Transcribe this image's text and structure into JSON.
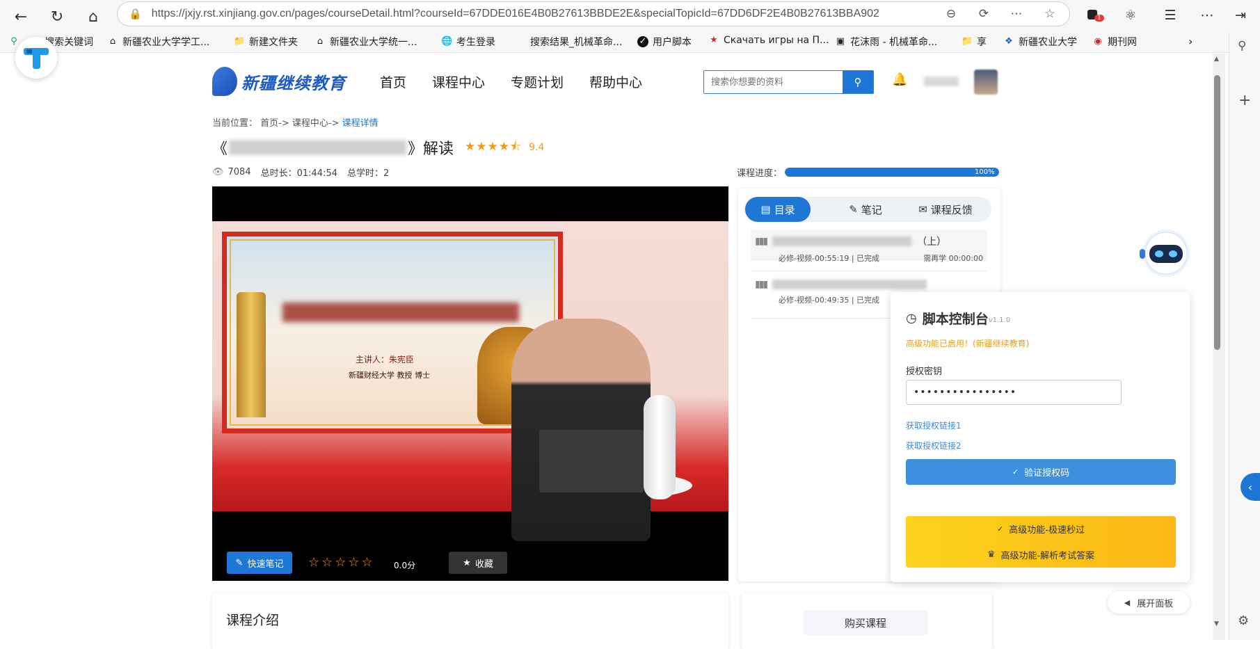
{
  "browser": {
    "url": "https://jxjy.rst.xinjiang.gov.cn/pages/courseDetail.html?courseId=67DDE016E4B0B27613BBDE2E&specialTopicId=67DD6DF2E4B0B27613BBA902",
    "badge_count": "1",
    "bookmarks": [
      {
        "label": "搜索关键词",
        "icon": "search-green-icon"
      },
      {
        "label": "新疆农业大学学工...",
        "icon": "house-icon"
      },
      {
        "label": "新建文件夹",
        "icon": "folder-icon"
      },
      {
        "label": "新疆农业大学统一...",
        "icon": "house-icon"
      },
      {
        "label": "考生登录",
        "icon": "globe-icon"
      },
      {
        "label": "搜索结果_机械革命...",
        "icon": "blank-icon"
      },
      {
        "label": "用户脚本",
        "icon": "script-icon"
      },
      {
        "label": "Скачать игры на П...",
        "icon": "game-icon"
      },
      {
        "label": "花沫雨 - 机械革命...",
        "icon": "image-icon"
      },
      {
        "label": "享",
        "icon": "folder-icon"
      },
      {
        "label": "新疆农业大学",
        "icon": "university-icon"
      },
      {
        "label": "期刊网",
        "icon": "journal-icon"
      }
    ]
  },
  "site": {
    "logo_text": "新疆继续教育",
    "nav": [
      "首页",
      "课程中心",
      "专题计划",
      "帮助中心"
    ],
    "search_placeholder": "搜索你想要的资料"
  },
  "breadcrumb": {
    "prefix": "当前位置：",
    "home": "首页->",
    "center": "课程中心->",
    "current": "课程详情"
  },
  "course": {
    "title_suffix": "》解读",
    "title_prefix": "《",
    "rating_stars": 4.5,
    "rating": "9.4",
    "views": "7084",
    "duration": "总时长：01:44:54",
    "hours": "总学时：2",
    "progress_label": "课程进度：",
    "progress_value": 1.0,
    "progress_text": "100%"
  },
  "video": {
    "speaker": "主讲人：朱宪臣",
    "speaker_title": "新疆财经大学  教授  博士",
    "note_button": "快速笔记",
    "user_score": "0.0分",
    "fav_button": "收藏"
  },
  "side_panel": {
    "tabs": [
      "目录",
      "笔记",
      "课程反馈"
    ],
    "lessons": [
      {
        "suffix": "（上）",
        "info": "必修-视频-00:55:19 | 已完成",
        "extra": "需再学 00:00:00"
      },
      {
        "suffix": "",
        "info": "必修-视频-00:49:35 | 已完成",
        "extra": ""
      }
    ]
  },
  "console": {
    "title": "脚本控制台",
    "version": "v1.1.0",
    "enabled": "高级功能已启用！(新疆继续教育)",
    "key_label": "授权密钥",
    "key_value": "••••••••••••••••",
    "link1": "获取授权链接1",
    "link2": "获取授权链接2",
    "verify_button": "验证授权码",
    "fast_button": "高级功能-极速秒过",
    "exam_button": "高级功能-解析考试答案"
  },
  "bottom": {
    "intro_title": "课程介绍",
    "buy_button": "购买课程",
    "expand_panel": "展开面板"
  },
  "colors": {
    "brand_blue": "#1e76d6",
    "star_orange": "#f39c12",
    "warning_text": "#e6a017",
    "gold_button": "#fbc21b"
  }
}
